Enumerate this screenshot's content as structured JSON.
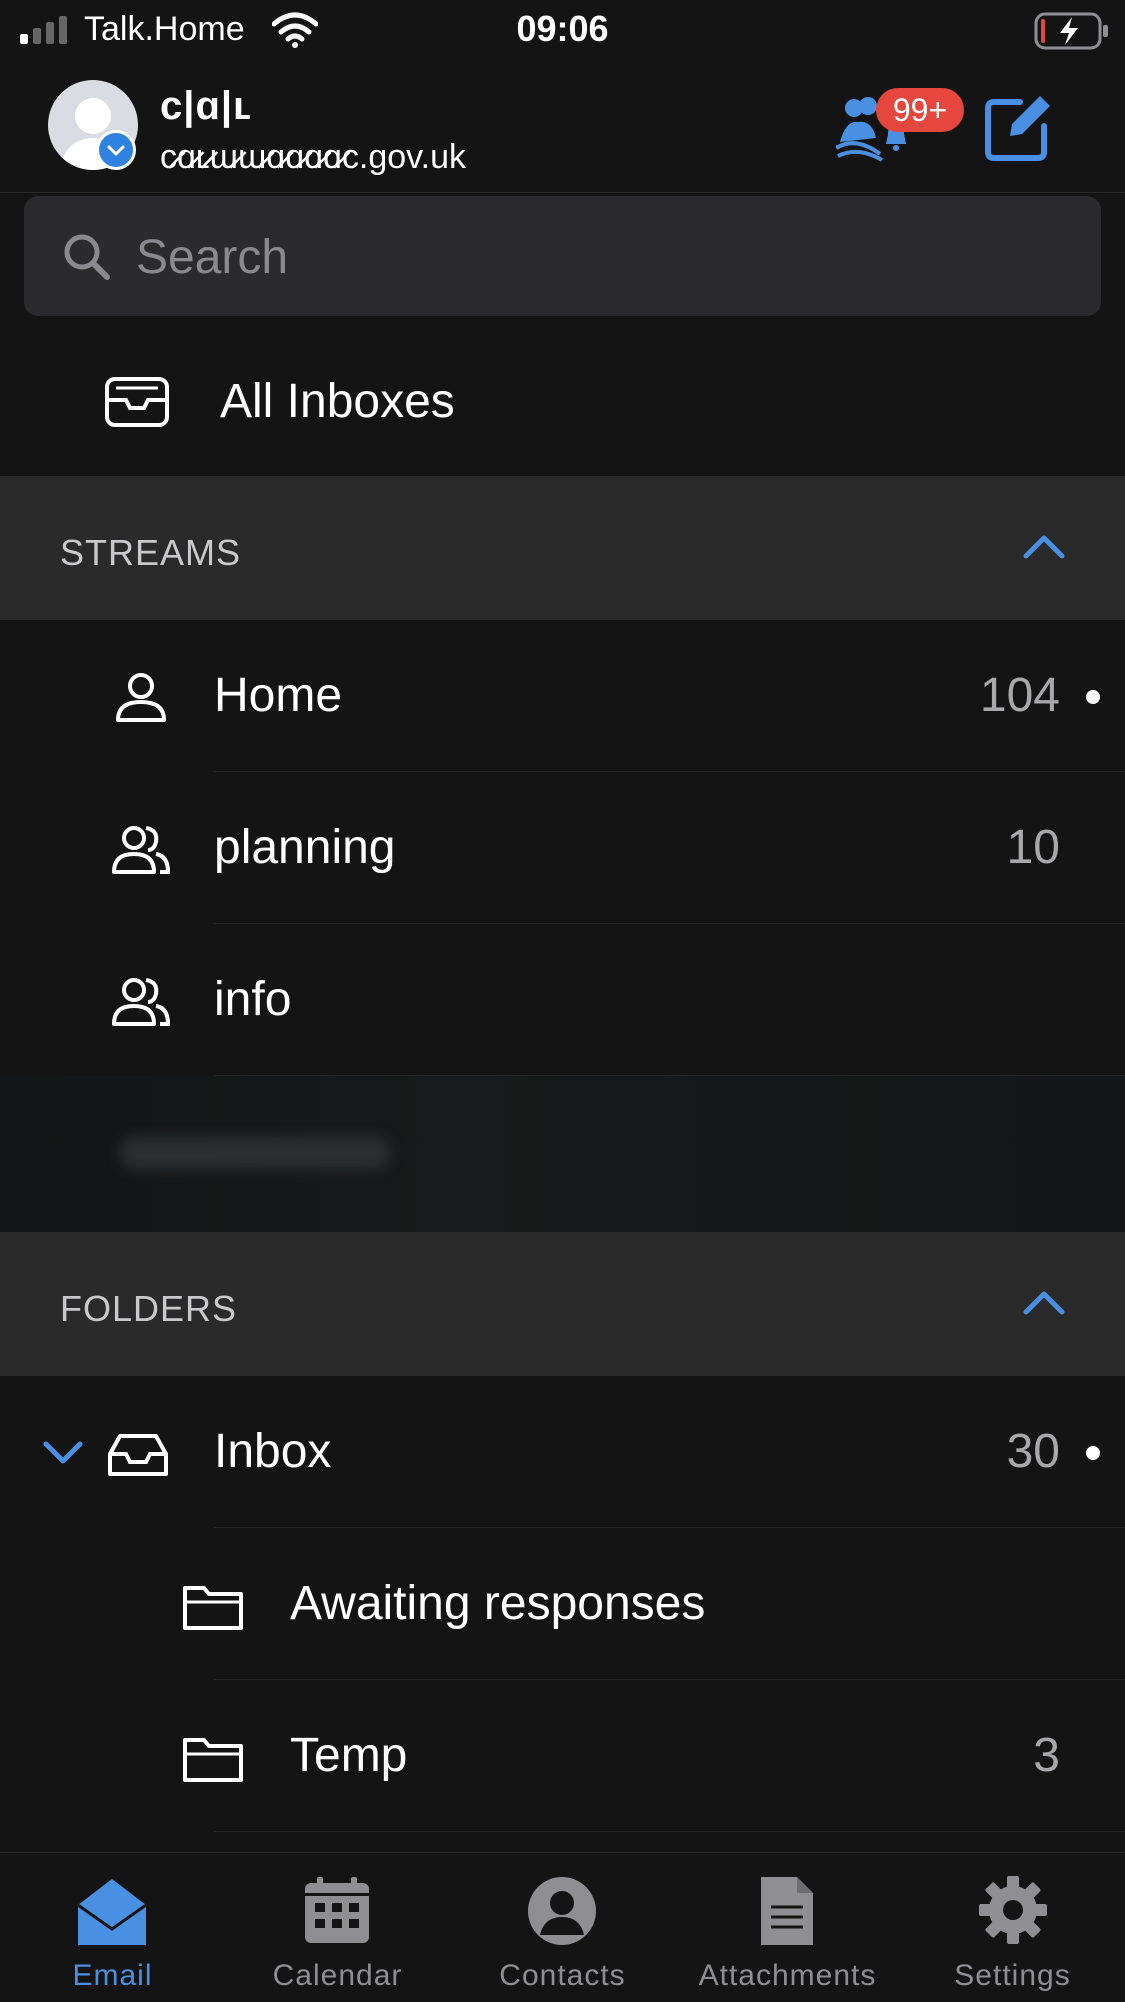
{
  "status_bar": {
    "carrier": "Talk.Home",
    "time": "09:06"
  },
  "header": {
    "account_name": "c|ɑ|ʟ",
    "account_email": "c̷ɑ̷ʟ̷ɯ̷ɯ̷ɑ̷ɑ̷ɑ̷ɑ̷c.gov.uk",
    "notification_count": "99+"
  },
  "search": {
    "placeholder": "Search"
  },
  "all_inboxes": {
    "label": "All Inboxes"
  },
  "streams": {
    "title": "STREAMS",
    "items": [
      {
        "label": "Home",
        "count": "104",
        "unread": true,
        "icon": "person-icon"
      },
      {
        "label": "planning",
        "count": "10",
        "unread": false,
        "icon": "group-icon"
      },
      {
        "label": "info",
        "count": "",
        "unread": false,
        "icon": "group-icon"
      }
    ]
  },
  "folders": {
    "title": "FOLDERS",
    "items": [
      {
        "label": "Inbox",
        "count": "30",
        "unread": true,
        "icon": "inbox-icon"
      },
      {
        "label": "Awaiting responses",
        "count": "",
        "unread": false,
        "icon": "folder-icon"
      },
      {
        "label": "Temp",
        "count": "3",
        "unread": false,
        "icon": "folder-icon"
      }
    ]
  },
  "tabs": [
    {
      "label": "Email",
      "active": true
    },
    {
      "label": "Calendar",
      "active": false
    },
    {
      "label": "Contacts",
      "active": false
    },
    {
      "label": "Attachments",
      "active": false
    },
    {
      "label": "Settings",
      "active": false
    }
  ],
  "colors": {
    "accent": "#4a90e2",
    "badge": "#e5463e",
    "background": "#141414",
    "section_header": "#2a2a2a"
  }
}
